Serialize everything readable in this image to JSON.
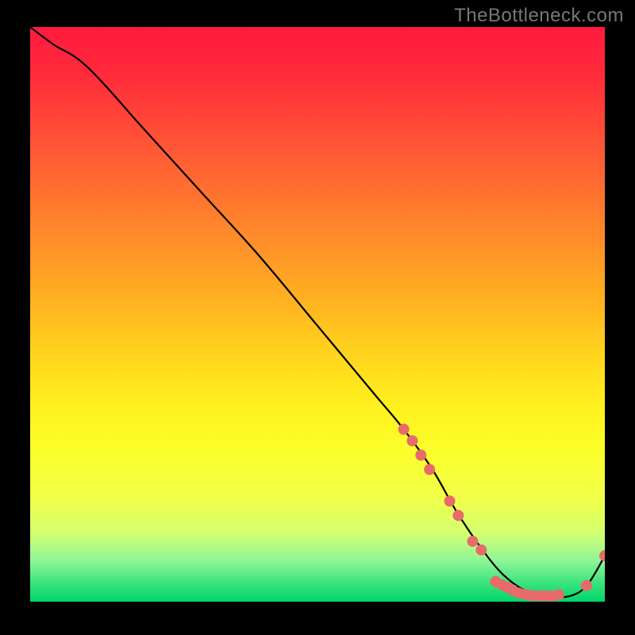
{
  "watermark": "TheBottleneck.com",
  "chart_data": {
    "type": "line",
    "title": "",
    "xlabel": "",
    "ylabel": "",
    "xlim": [
      0,
      100
    ],
    "ylim": [
      0,
      100
    ],
    "grid": false,
    "legend": "none",
    "series": [
      {
        "name": "bottleneck-curve",
        "x": [
          0,
          4,
          10,
          20,
          30,
          40,
          50,
          60,
          65,
          70,
          74,
          78,
          82,
          86,
          90,
          94,
          97,
          100
        ],
        "y": [
          100,
          97,
          93,
          82,
          71,
          60,
          48,
          36,
          30,
          23,
          16,
          10,
          5,
          2,
          1,
          1,
          3,
          8
        ]
      }
    ],
    "markers": [
      {
        "x": 65.0,
        "y": 30.0
      },
      {
        "x": 66.5,
        "y": 28.0
      },
      {
        "x": 68.0,
        "y": 25.5
      },
      {
        "x": 69.5,
        "y": 23.0
      },
      {
        "x": 73.0,
        "y": 17.5
      },
      {
        "x": 74.5,
        "y": 15.0
      },
      {
        "x": 77.0,
        "y": 10.5
      },
      {
        "x": 78.5,
        "y": 9.0
      },
      {
        "x": 81.0,
        "y": 3.5
      },
      {
        "x": 82.0,
        "y": 3.0
      },
      {
        "x": 83.0,
        "y": 2.5
      },
      {
        "x": 84.0,
        "y": 2.0
      },
      {
        "x": 85.0,
        "y": 1.5
      },
      {
        "x": 86.0,
        "y": 1.3
      },
      {
        "x": 87.0,
        "y": 1.1
      },
      {
        "x": 88.0,
        "y": 1.0
      },
      {
        "x": 89.0,
        "y": 1.0
      },
      {
        "x": 90.0,
        "y": 1.0
      },
      {
        "x": 91.0,
        "y": 1.0
      },
      {
        "x": 92.0,
        "y": 1.2
      },
      {
        "x": 96.8,
        "y": 2.8
      },
      {
        "x": 100.0,
        "y": 8.0
      }
    ],
    "marker_color": "#e86a6a",
    "line_color": "#000000"
  }
}
